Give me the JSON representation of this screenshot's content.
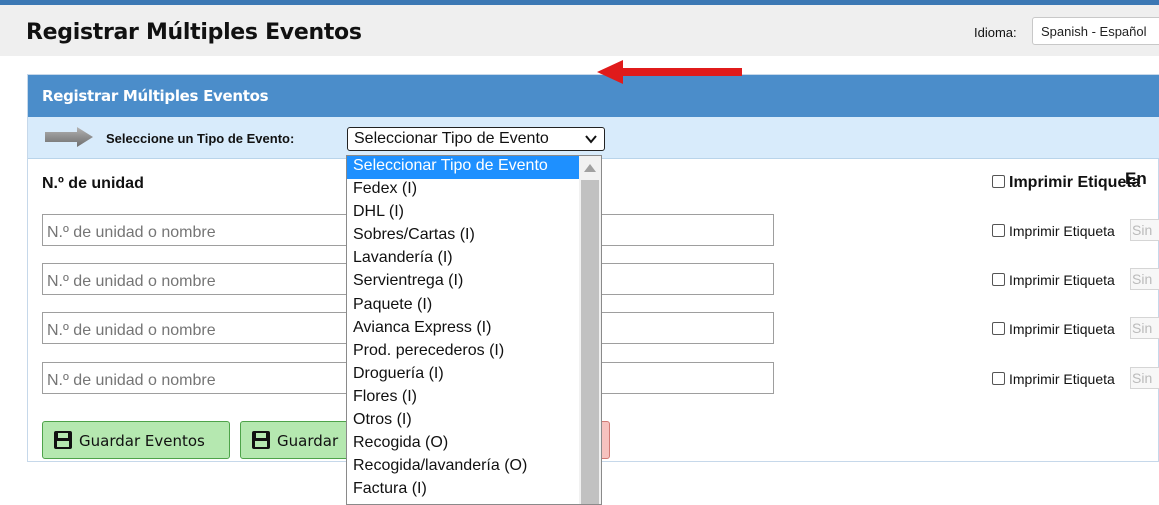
{
  "header": {
    "title": "Registrar Múltiples Eventos",
    "language_label": "Idioma:",
    "language_value": "Spanish - Español"
  },
  "panel": {
    "title": "Registrar Múltiples Eventos",
    "event_type_label": "Seleccione un Tipo de Evento:",
    "event_type_value": "Seleccionar Tipo de Evento"
  },
  "columns": {
    "unit": "N.º de unidad",
    "print_label": "Imprimir Etiqueta",
    "extra": "En"
  },
  "rows": [
    {
      "unit_placeholder": "N.º de unidad o nombre",
      "print_label": "Imprimir Etiqueta",
      "extra": "Sin"
    },
    {
      "unit_placeholder": "N.º de unidad o nombre",
      "print_label": "Imprimir Etiqueta",
      "extra": "Sin"
    },
    {
      "unit_placeholder": "N.º de unidad o nombre",
      "print_label": "Imprimir Etiqueta",
      "extra": "Sin"
    },
    {
      "unit_placeholder": "N.º de unidad o nombre",
      "print_label": "Imprimir Etiqueta",
      "extra": "Sin"
    }
  ],
  "buttons": {
    "save_events": "Guardar Eventos",
    "save_second": "Guardar"
  },
  "dropdown": {
    "options": [
      "Seleccionar Tipo de Evento",
      "Fedex (I)",
      "DHL (I)",
      "Sobres/Cartas (I)",
      "Lavandería (I)",
      "Servientrega (I)",
      "Paquete (I)",
      "Avianca Express (I)",
      "Prod. perecederos (I)",
      "Droguería (I)",
      "Flores (I)",
      "Otros (I)",
      "Recogida (O)",
      "Recogida/lavandería (O)",
      "Factura (I)"
    ],
    "selected_index": 0
  },
  "colors": {
    "panel_header": "#4b8dca",
    "event_bar": "#d8ebfb",
    "save_button": "#b5e8b0",
    "selected_option": "#1e90ff",
    "annotation_arrow": "#e01b1b"
  }
}
